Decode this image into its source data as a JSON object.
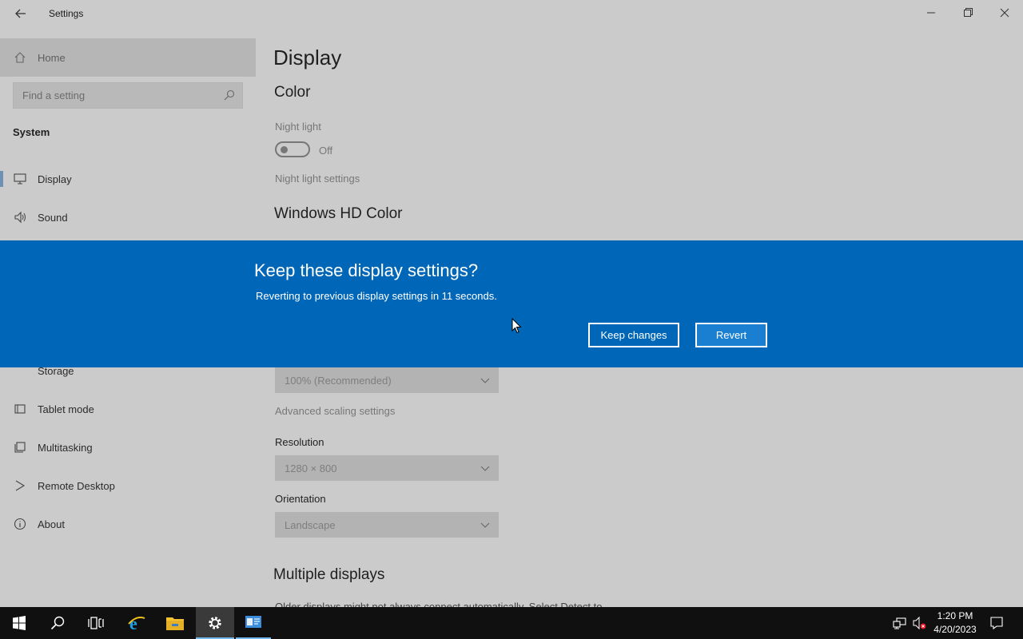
{
  "window": {
    "title": "Settings"
  },
  "sidebar": {
    "home_label": "Home",
    "search_placeholder": "Find a setting",
    "section_label": "System",
    "items_top": [
      {
        "label": "Display",
        "icon": "monitor-icon",
        "active": true
      },
      {
        "label": "Sound",
        "icon": "speaker-icon"
      }
    ],
    "items_bottom": [
      {
        "label": "Storage",
        "icon": "storage-icon"
      },
      {
        "label": "Tablet mode",
        "icon": "tablet-mode-icon"
      },
      {
        "label": "Multitasking",
        "icon": "multitasking-icon"
      },
      {
        "label": "Remote Desktop",
        "icon": "remote-desktop-icon"
      },
      {
        "label": "About",
        "icon": "info-icon"
      }
    ]
  },
  "main": {
    "page_title": "Display",
    "color_heading": "Color",
    "night_light_label": "Night light",
    "night_light_state": "Off",
    "night_light_settings_link": "Night light settings",
    "hd_color_heading": "Windows HD Color",
    "scale_value": "100% (Recommended)",
    "advanced_scaling_link": "Advanced scaling settings",
    "resolution_label": "Resolution",
    "resolution_value": "1280 × 800",
    "orientation_label": "Orientation",
    "orientation_value": "Landscape",
    "multiple_displays_heading": "Multiple displays",
    "multiple_displays_text": "Older displays might not always connect automatically. Select Detect to"
  },
  "dialog": {
    "title": "Keep these display settings?",
    "message": "Reverting to previous display settings in 11 seconds.",
    "countdown_seconds": 11,
    "keep_label": "Keep changes",
    "revert_label": "Revert"
  },
  "taskbar": {
    "time": "1:20 PM",
    "date": "4/20/2023",
    "apps": [
      "start-icon",
      "search-icon",
      "task-view-icon",
      "internet-explorer-icon",
      "file-explorer-icon",
      "settings-icon",
      "server-manager-icon"
    ]
  },
  "colors": {
    "accent": "#0067b8",
    "dialog_bg": "#0067b8",
    "taskbar": "#101010",
    "dimmed_bg": "#cbcbcb"
  }
}
